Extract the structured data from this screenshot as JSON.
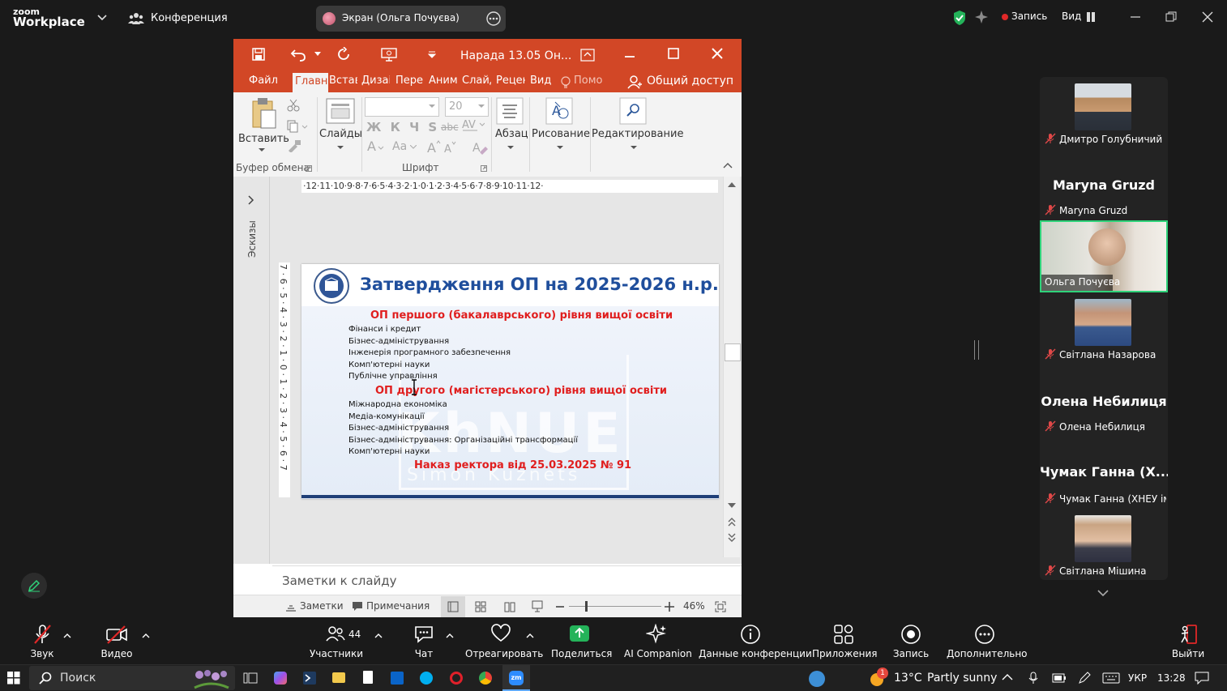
{
  "zoom": {
    "logo_top": "zoom",
    "logo_bottom": "Workplace",
    "meeting_label": "Конференция",
    "share_title": "Экран (Ольга Почуєва)",
    "record_label": "Запись",
    "view_label": "Вид",
    "record_color": "#e02828",
    "shield_color": "#24b35a"
  },
  "pp": {
    "title": "Нарада 13.05 Он...",
    "tabs": [
      "Файл",
      "Главн",
      "Встав",
      "Дизаі",
      "Пере",
      "Аним",
      "Слайд",
      "Рецен",
      "Вид"
    ],
    "help": "Помо",
    "share": "Общий доступ",
    "ribbon": {
      "paste": "Вставить",
      "slides": "Слайды",
      "font_size": "20",
      "font_buttons": "Ж К Ч S",
      "abc": "abc",
      "case": "Aa",
      "paragraph": "Абзац",
      "drawing": "Рисование",
      "editing": "Редактирование",
      "group_clipboard": "Буфер обмена",
      "group_font": "Шрифт"
    },
    "ruler_h": "·12·11·10·9·8·7·6·5·4·3·2·1·0·1·2·3·4·5·6·7·8·9·10·11·12·",
    "ruler_v": "7·6·5·4·3·2·1·0·1·2·3·4·5·6·7",
    "thumbs_label": "Эскизы",
    "notes_placeholder": "Заметки к слайду",
    "status": {
      "notes": "Заметки",
      "comments": "Примечания",
      "zoom": "46%"
    },
    "accent": "#d24726"
  },
  "slide": {
    "title": "Затвердження ОП на 2025-2026 н.р.",
    "section1": "ОП першого (бакалаврського) рівня вищої освіти",
    "list1": [
      "Фінанси і кредит",
      "Бізнес-адміністрування",
      "Інженерія програмного забезпечення",
      "Комп'ютерні науки",
      "Публічне управління"
    ],
    "section2": "ОП другого (магістерського) рівня вищої освіти",
    "list2": [
      "Міжнародна економіка",
      "Медіа-комунікації",
      "Бізнес-адміністрування",
      "Бізнес-адміністрування: Організаційні трансформації",
      "Комп'ютерні науки"
    ],
    "footer": "Наказ ректора від 25.03.2025 № 91",
    "watermark": "KhNUE",
    "watermark_sub": "Simon Kuznets",
    "title_color": "#1f4e9c",
    "section_color": "#e01e1e"
  },
  "participants": [
    {
      "name": "Дмитро Голубничий",
      "video": true
    },
    {
      "name": "Maryna Gruzd",
      "video": false
    },
    {
      "name": "Ольга Почуєва",
      "video": true,
      "active": true
    },
    {
      "name": "Світлана Назарова",
      "video": true
    },
    {
      "name": "Олена Небилиця",
      "video": false
    },
    {
      "name": "Чумак Ганна (ХНЕУ ім...",
      "big": "Чумак Ганна (Х...",
      "video": false
    },
    {
      "name": "Світлана Мішина",
      "video": true
    }
  ],
  "toolbar": {
    "audio": "Звук",
    "video": "Видео",
    "participants": "Участники",
    "participants_count": "44",
    "chat": "Чат",
    "react": "Отреагировать",
    "share": "Поделиться",
    "ai": "AI Companion",
    "info": "Данные конференции",
    "apps": "Приложения",
    "record": "Запись",
    "more": "Дополнительно",
    "leave": "Выйти",
    "share_color": "#24b35a",
    "leave_color": "#e02828"
  },
  "taskbar": {
    "search": "Поиск",
    "weather_temp": "13°C",
    "weather_desc": "Partly sunny",
    "lang": "УКР",
    "time": "13:28",
    "notif_count": "1"
  }
}
